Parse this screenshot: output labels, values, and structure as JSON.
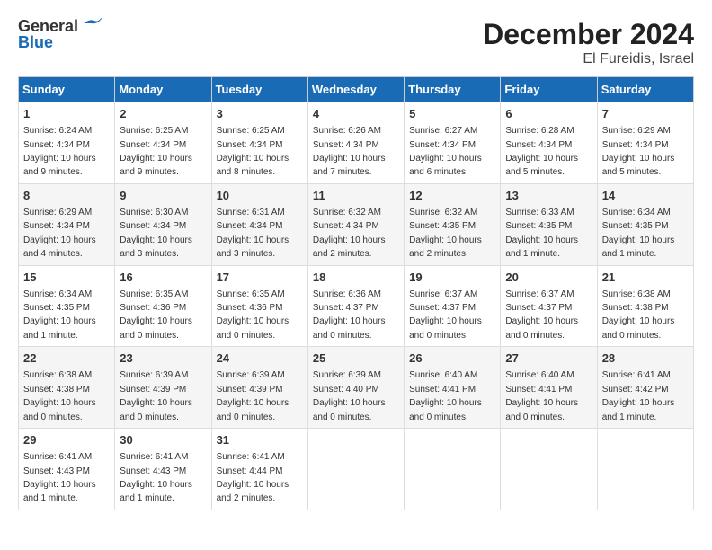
{
  "logo": {
    "general": "General",
    "blue": "Blue"
  },
  "title": "December 2024",
  "subtitle": "El Fureidis, Israel",
  "weekdays": [
    "Sunday",
    "Monday",
    "Tuesday",
    "Wednesday",
    "Thursday",
    "Friday",
    "Saturday"
  ],
  "weeks": [
    [
      {
        "day": "1",
        "sunrise": "6:24 AM",
        "sunset": "4:34 PM",
        "daylight": "10 hours and 9 minutes."
      },
      {
        "day": "2",
        "sunrise": "6:25 AM",
        "sunset": "4:34 PM",
        "daylight": "10 hours and 9 minutes."
      },
      {
        "day": "3",
        "sunrise": "6:25 AM",
        "sunset": "4:34 PM",
        "daylight": "10 hours and 8 minutes."
      },
      {
        "day": "4",
        "sunrise": "6:26 AM",
        "sunset": "4:34 PM",
        "daylight": "10 hours and 7 minutes."
      },
      {
        "day": "5",
        "sunrise": "6:27 AM",
        "sunset": "4:34 PM",
        "daylight": "10 hours and 6 minutes."
      },
      {
        "day": "6",
        "sunrise": "6:28 AM",
        "sunset": "4:34 PM",
        "daylight": "10 hours and 5 minutes."
      },
      {
        "day": "7",
        "sunrise": "6:29 AM",
        "sunset": "4:34 PM",
        "daylight": "10 hours and 5 minutes."
      }
    ],
    [
      {
        "day": "8",
        "sunrise": "6:29 AM",
        "sunset": "4:34 PM",
        "daylight": "10 hours and 4 minutes."
      },
      {
        "day": "9",
        "sunrise": "6:30 AM",
        "sunset": "4:34 PM",
        "daylight": "10 hours and 3 minutes."
      },
      {
        "day": "10",
        "sunrise": "6:31 AM",
        "sunset": "4:34 PM",
        "daylight": "10 hours and 3 minutes."
      },
      {
        "day": "11",
        "sunrise": "6:32 AM",
        "sunset": "4:34 PM",
        "daylight": "10 hours and 2 minutes."
      },
      {
        "day": "12",
        "sunrise": "6:32 AM",
        "sunset": "4:35 PM",
        "daylight": "10 hours and 2 minutes."
      },
      {
        "day": "13",
        "sunrise": "6:33 AM",
        "sunset": "4:35 PM",
        "daylight": "10 hours and 1 minute."
      },
      {
        "day": "14",
        "sunrise": "6:34 AM",
        "sunset": "4:35 PM",
        "daylight": "10 hours and 1 minute."
      }
    ],
    [
      {
        "day": "15",
        "sunrise": "6:34 AM",
        "sunset": "4:35 PM",
        "daylight": "10 hours and 1 minute."
      },
      {
        "day": "16",
        "sunrise": "6:35 AM",
        "sunset": "4:36 PM",
        "daylight": "10 hours and 0 minutes."
      },
      {
        "day": "17",
        "sunrise": "6:35 AM",
        "sunset": "4:36 PM",
        "daylight": "10 hours and 0 minutes."
      },
      {
        "day": "18",
        "sunrise": "6:36 AM",
        "sunset": "4:37 PM",
        "daylight": "10 hours and 0 minutes."
      },
      {
        "day": "19",
        "sunrise": "6:37 AM",
        "sunset": "4:37 PM",
        "daylight": "10 hours and 0 minutes."
      },
      {
        "day": "20",
        "sunrise": "6:37 AM",
        "sunset": "4:37 PM",
        "daylight": "10 hours and 0 minutes."
      },
      {
        "day": "21",
        "sunrise": "6:38 AM",
        "sunset": "4:38 PM",
        "daylight": "10 hours and 0 minutes."
      }
    ],
    [
      {
        "day": "22",
        "sunrise": "6:38 AM",
        "sunset": "4:38 PM",
        "daylight": "10 hours and 0 minutes."
      },
      {
        "day": "23",
        "sunrise": "6:39 AM",
        "sunset": "4:39 PM",
        "daylight": "10 hours and 0 minutes."
      },
      {
        "day": "24",
        "sunrise": "6:39 AM",
        "sunset": "4:39 PM",
        "daylight": "10 hours and 0 minutes."
      },
      {
        "day": "25",
        "sunrise": "6:39 AM",
        "sunset": "4:40 PM",
        "daylight": "10 hours and 0 minutes."
      },
      {
        "day": "26",
        "sunrise": "6:40 AM",
        "sunset": "4:41 PM",
        "daylight": "10 hours and 0 minutes."
      },
      {
        "day": "27",
        "sunrise": "6:40 AM",
        "sunset": "4:41 PM",
        "daylight": "10 hours and 0 minutes."
      },
      {
        "day": "28",
        "sunrise": "6:41 AM",
        "sunset": "4:42 PM",
        "daylight": "10 hours and 1 minute."
      }
    ],
    [
      {
        "day": "29",
        "sunrise": "6:41 AM",
        "sunset": "4:43 PM",
        "daylight": "10 hours and 1 minute."
      },
      {
        "day": "30",
        "sunrise": "6:41 AM",
        "sunset": "4:43 PM",
        "daylight": "10 hours and 1 minute."
      },
      {
        "day": "31",
        "sunrise": "6:41 AM",
        "sunset": "4:44 PM",
        "daylight": "10 hours and 2 minutes."
      },
      null,
      null,
      null,
      null
    ]
  ],
  "labels": {
    "sunrise": "Sunrise:",
    "sunset": "Sunset:",
    "daylight": "Daylight:"
  }
}
